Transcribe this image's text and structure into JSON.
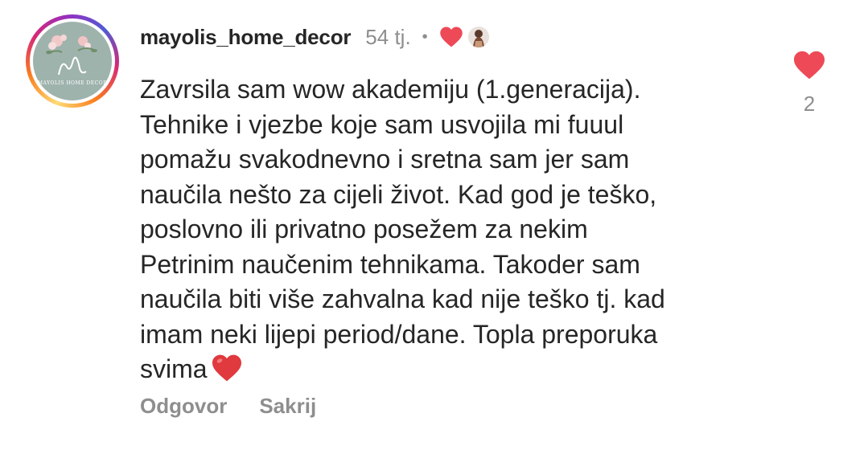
{
  "comment": {
    "username": "mayolis_home_decor",
    "time_ago": "54 tj.",
    "separator": "•",
    "avatar_caption": "MAYOLIS HOME DECOR",
    "text": "Zavrsila sam wow akademiju (1.generacija).\nTehnike i vjezbe koje sam usvojila mi fuuul\npomažu svakodnevno i sretna sam jer sam\nnaučila nešto za cijeli život. Kad god je teško,\nposlovno ili privatno posežem za nekim\nPetrinim naučenim tehnikama. Takoder sam\nnaučila biti više zahvalna kad nije teško tj. kad\nimam neki lijepi period/dane. Topla preporuka\nsvima",
    "reply_label": "Odgovor",
    "hide_label": "Sakrij",
    "like_count": "2"
  },
  "icons": {
    "heart": "heart-icon",
    "creator_heart": "creator-heart-icon",
    "inline_emoji": "red-heart-emoji"
  },
  "colors": {
    "heart_red": "#ed4956",
    "emoji_red": "#e0393e",
    "muted_text": "#8e8e8e",
    "primary_text": "#262626",
    "avatar_bg": "#9fb3ad"
  }
}
